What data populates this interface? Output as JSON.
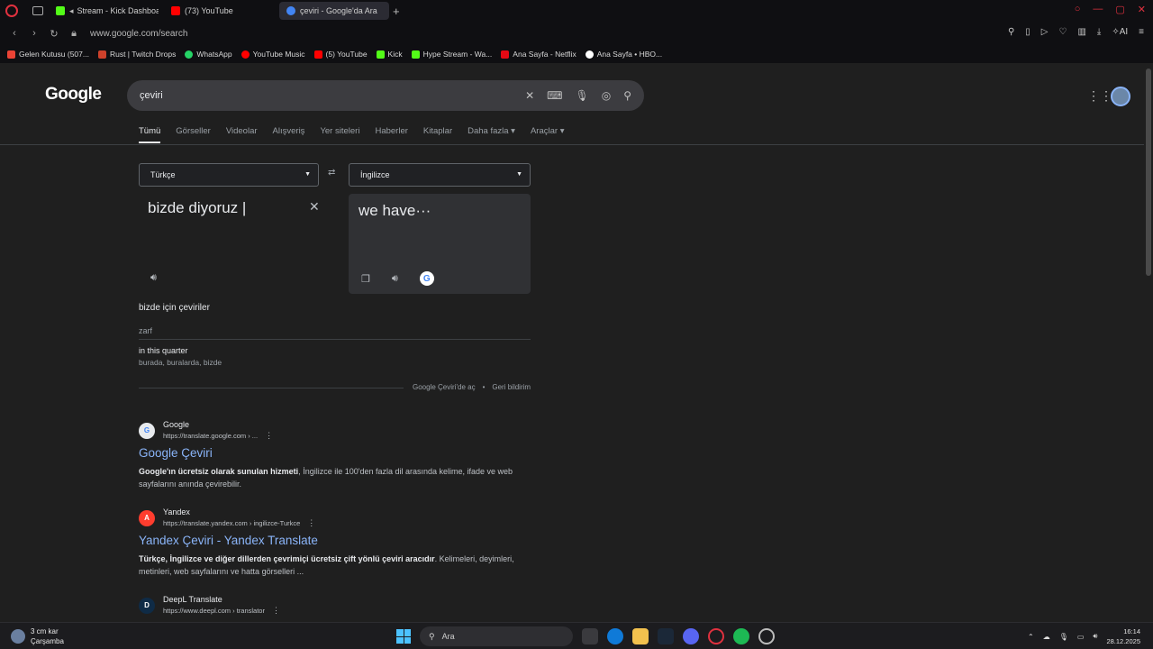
{
  "browser": {
    "tabs": [
      {
        "label": "Stream - Kick Dashboard",
        "active": false,
        "color": "#53fc18"
      },
      {
        "label": "(73) YouTube",
        "active": false,
        "color": "#ff0000"
      },
      {
        "label": "çeviri - Google'da Ara",
        "active": true,
        "color": "#4285f4"
      }
    ],
    "new_tab": "+",
    "url": "www.google.com/search",
    "bookmarks": [
      {
        "label": "Gelen Kutusu (507...",
        "color": "#ea4335"
      },
      {
        "label": "Rust | Twitch Drops",
        "color": "#ce412b"
      },
      {
        "label": "WhatsApp",
        "color": "#25d366"
      },
      {
        "label": "YouTube Music",
        "color": "#ff0000"
      },
      {
        "label": "(5) YouTube",
        "color": "#ff0000"
      },
      {
        "label": "Kick",
        "color": "#53fc18"
      },
      {
        "label": "Hype Stream - Wa...",
        "color": "#53fc18"
      },
      {
        "label": "Ana Sayfa - Netflix",
        "color": "#e50914"
      },
      {
        "label": "Ana Sayfa • HBO...",
        "color": "#ffffff"
      }
    ]
  },
  "google": {
    "logo": "Google",
    "query": "çeviri",
    "tabs": [
      "Tümü",
      "Görseller",
      "Videolar",
      "Alışveriş",
      "Yer siteleri",
      "Haberler",
      "Kitaplar",
      "Daha fazla",
      "Araçlar"
    ]
  },
  "translate": {
    "source_lang": "Türkçe",
    "target_lang": "İngilizce",
    "source_text": "bizde diyoruz",
    "output_text": "we have···",
    "translations_title": "bizde için çeviriler",
    "pos": "zarf",
    "def_main": "in this quarter",
    "def_sub": "burada, buralarda, bizde",
    "open_link": "Google Çeviri'de aç",
    "feedback": "Geri bildirim"
  },
  "results": [
    {
      "site": "Google",
      "url": "https://translate.google.com › ...",
      "title": "Google Çeviri",
      "snippet_bold": "Google'ın ücretsiz olarak sunulan hizmeti",
      "snippet": ", İngilizce ile 100'den fazla dil arasında kelime, ifade ve web sayfalarını anında çevirebilir.",
      "fav": "G"
    },
    {
      "site": "Yandex",
      "url": "https://translate.yandex.com › ingilizce-Turkce",
      "title": "Yandex Çeviri - Yandex Translate",
      "snippet_bold": "Türkçe, İngilizce ve diğer dillerden çevrimiçi ücretsiz çift yönlü çeviri aracıdır",
      "snippet": ". Kelimeleri, deyimleri, metinleri, web sayfalarını ve hatta görselleri ...",
      "fav": "A"
    },
    {
      "site": "DeepL Translate",
      "url": "https://www.deepl.com › translator",
      "title": "",
      "snippet_bold": "",
      "snippet": "",
      "fav": "D"
    }
  ],
  "taskbar": {
    "weather_temp": "3 cm kar",
    "weather_day": "Çarşamba",
    "search_placeholder": "Ara",
    "time": "16:14",
    "date": "28.12.2025"
  }
}
